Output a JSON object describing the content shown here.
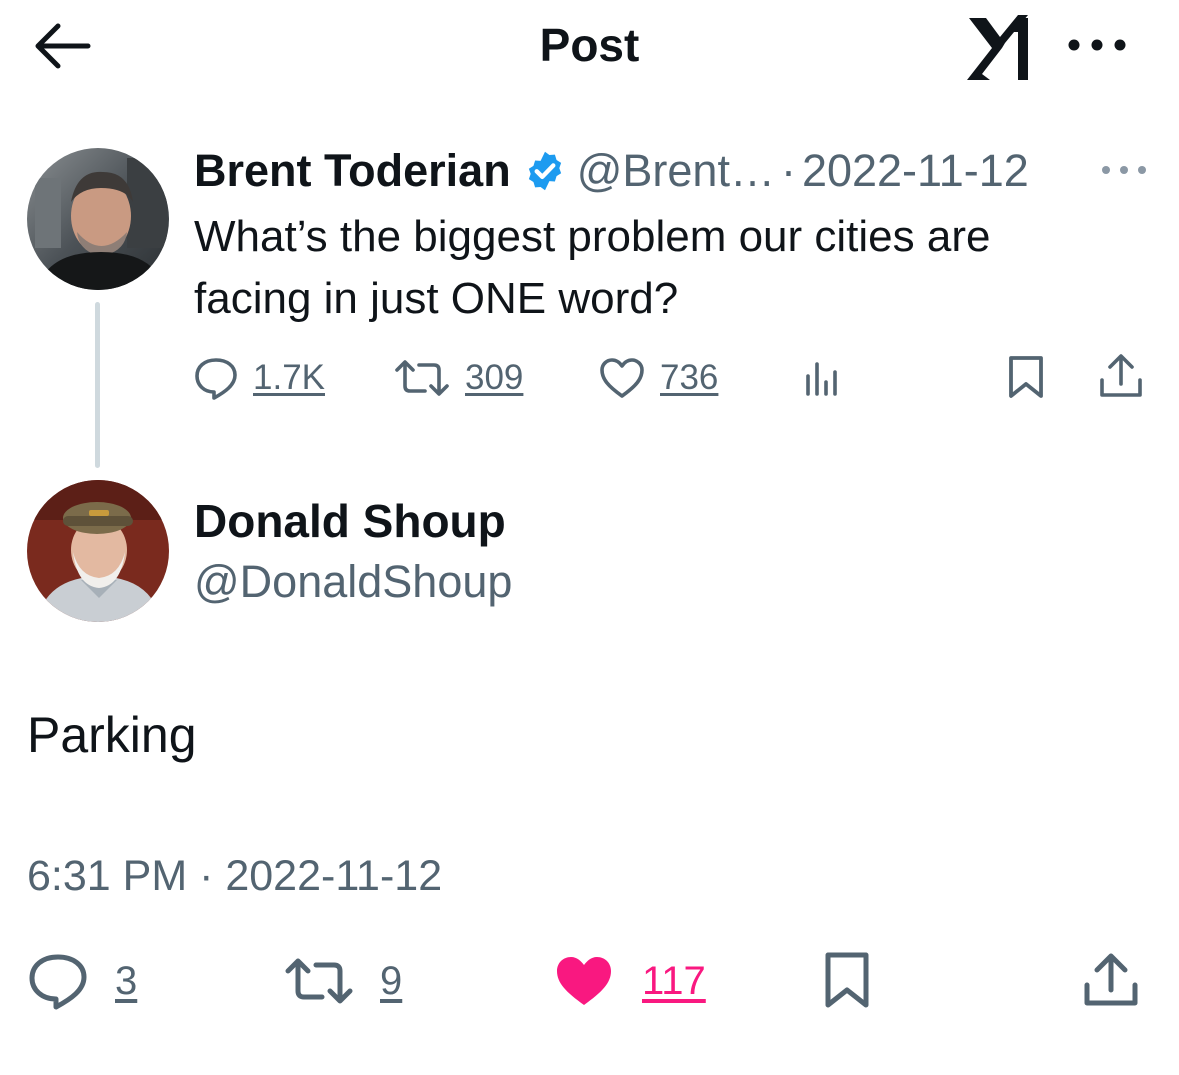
{
  "header": {
    "title": "Post",
    "back_icon": "arrow-left-icon",
    "logo_icon": "x-logo-icon",
    "more_icon": "more-horizontal-icon"
  },
  "parent_post": {
    "author_name": "Brent Toderian",
    "verified_icon": "verified-badge-icon",
    "verified_color": "#1d9bf0",
    "handle": "@Brent…",
    "separator": "·",
    "date": "2022-11-12",
    "text": "What’s the biggest problem our cities are facing in just ONE word?",
    "actions": {
      "replies": "1.7K",
      "reposts": "309",
      "likes": "736"
    }
  },
  "main_post": {
    "author_name": "Donald Shoup",
    "handle": "@DonaldShoup",
    "text": "Parking",
    "timestamp": "6:31 PM · 2022-11-12",
    "actions": {
      "replies": "3",
      "reposts": "9",
      "likes": "117",
      "liked": true,
      "like_color": "#f91880"
    }
  },
  "colors": {
    "text_primary": "#0f1419",
    "text_secondary": "#536471",
    "thread_line": "#cfd9de"
  }
}
